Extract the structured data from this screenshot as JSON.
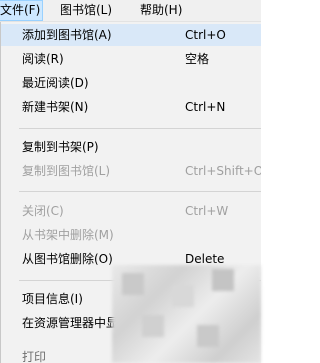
{
  "menubar": {
    "items": [
      {
        "label": "文件(F)",
        "active": true
      },
      {
        "label": "图书馆(L)",
        "active": false
      },
      {
        "label": "帮助(H)",
        "active": false
      }
    ]
  },
  "menu": {
    "items": [
      {
        "label": "添加到图书馆(A)",
        "shortcut": "Ctrl+O",
        "disabled": false,
        "highlighted": true
      },
      {
        "label": "阅读(R)",
        "shortcut": "空格",
        "disabled": false
      },
      {
        "label": "最近阅读(D)",
        "shortcut": "",
        "disabled": false
      },
      {
        "label": "新建书架(N)",
        "shortcut": "Ctrl+N",
        "disabled": false
      },
      {
        "label": "复制到书架(P)",
        "shortcut": "",
        "disabled": false
      },
      {
        "label": "复制到图书馆(L)",
        "shortcut": "Ctrl+Shift+O",
        "disabled": true
      },
      {
        "label": "关闭(C)",
        "shortcut": "Ctrl+W",
        "disabled": true
      },
      {
        "label": "从书架中删除(M)",
        "shortcut": "",
        "disabled": true
      },
      {
        "label": "从图书馆删除(O)",
        "shortcut": "Delete",
        "disabled": false
      },
      {
        "label": "项目信息(I)",
        "shortcut": "",
        "disabled": false
      },
      {
        "label": "在资源管理器中显",
        "shortcut": "",
        "disabled": false
      },
      {
        "label": "打印",
        "shortcut": "",
        "disabled": false
      }
    ]
  },
  "colors": {
    "menu_background": "#f2f2f2",
    "highlight": "#d9e8f8",
    "disabled_text": "#a0a0a0"
  }
}
